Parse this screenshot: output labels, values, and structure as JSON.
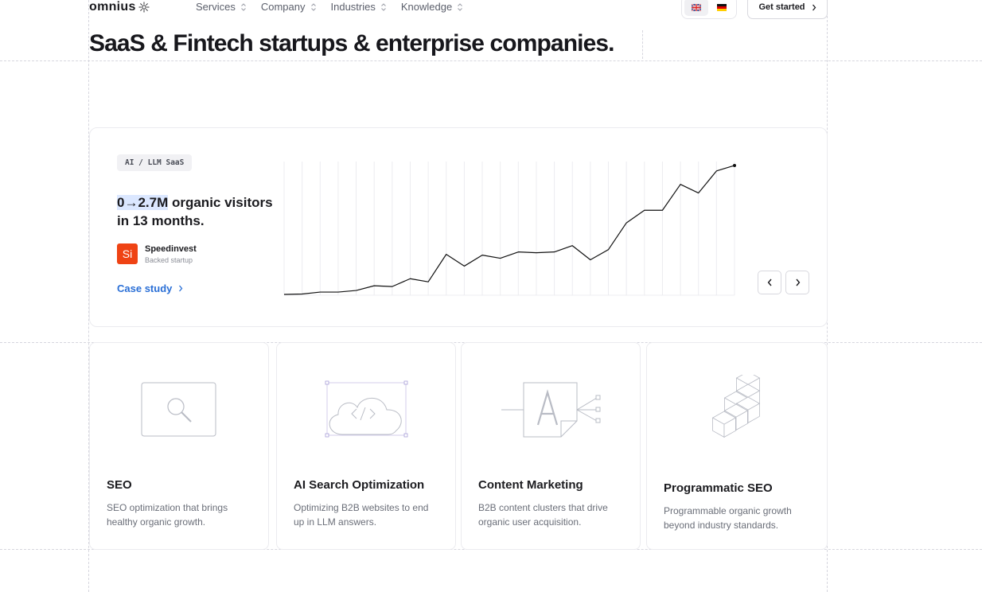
{
  "nav": {
    "logo_text": "omnius",
    "items": [
      {
        "label": "Services"
      },
      {
        "label": "Company"
      },
      {
        "label": "Industries"
      },
      {
        "label": "Knowledge"
      }
    ],
    "languages": [
      {
        "code": "en",
        "flag_icon": "uk-flag-icon",
        "active": true
      },
      {
        "code": "de",
        "flag_icon": "germany-flag-icon",
        "active": false
      }
    ],
    "cta_label": "Get started"
  },
  "hero": {
    "headline": "SaaS & Fintech startups & enterprise companies."
  },
  "case_study": {
    "tag": "AI / LLM SaaS",
    "stat_highlight": "0→2.7M",
    "stat_rest": " organic visitors in 13 months.",
    "company_logo_text": "Si",
    "company_name": "Speedinvest",
    "company_sub": "Backed startup",
    "link_label": "Case study",
    "accent_color": "#ef4314",
    "link_color": "#2a6fd6"
  },
  "chart_data": {
    "type": "line",
    "title": "",
    "xlabel": "",
    "ylabel": "",
    "values": [
      1,
      1.5,
      4,
      4,
      6,
      12,
      11,
      21,
      17,
      52,
      37,
      51,
      47,
      55,
      54,
      55,
      63,
      45,
      58,
      92,
      108,
      108,
      141,
      130,
      158,
      165
    ],
    "ylim": [
      0,
      170
    ],
    "grid": "vertical"
  },
  "services": [
    {
      "title": "SEO",
      "description": "SEO optimization that brings healthy organic growth.",
      "icon": "magnifier-icon"
    },
    {
      "title": "AI Search Optimization",
      "description": "Optimizing B2B websites to end up in LLM answers.",
      "icon": "cloud-code-icon"
    },
    {
      "title": "Content Marketing",
      "description": "B2B content clusters that drive organic user acquisition.",
      "icon": "document-branch-icon"
    },
    {
      "title": "Programmatic SEO",
      "description": "Programmable organic growth beyond industry standards.",
      "icon": "cubes-stack-icon"
    }
  ]
}
